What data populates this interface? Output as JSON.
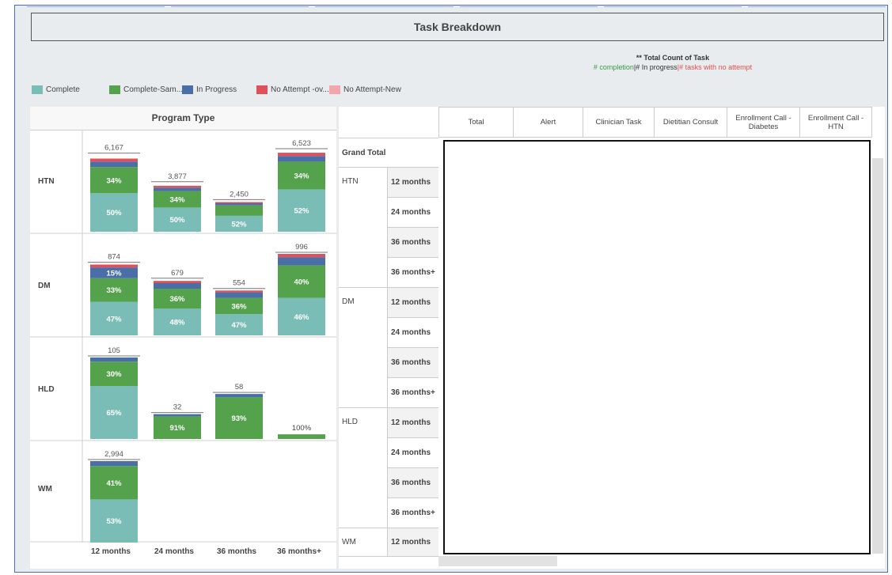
{
  "header": {
    "title": "Task Breakdown",
    "note_title": "** Total Count of Task",
    "note_completion": "# completion",
    "note_sep1": "|",
    "note_progress": "# In progress",
    "note_sep2": "|",
    "note_noattempt": "# tasks with no attempt"
  },
  "legend": [
    {
      "label": "Complete",
      "color": "#79bdb6"
    },
    {
      "label": "Complete-Sam...",
      "color": "#55a24d"
    },
    {
      "label": "In Progress",
      "color": "#4a6fa8"
    },
    {
      "label": "No Attempt -ov...",
      "color": "#e0505a"
    },
    {
      "label": "No Attempt-New",
      "color": "#f4a4ac"
    }
  ],
  "panel_title": "Program Type",
  "chart_data": {
    "type": "bar",
    "stacked": true,
    "title": "Program Type",
    "categories": [
      "12 months",
      "24 months",
      "36 months",
      "36 months+"
    ],
    "rows": [
      "HTN",
      "DM",
      "HLD",
      "WM"
    ],
    "series_names": [
      "Complete",
      "Complete-Sam...",
      "In Progress",
      "No Attempt -ov...",
      "No Attempt-New"
    ],
    "colors": {
      "Complete": "#79bdb6",
      "Complete-Sam...": "#55a24d",
      "In Progress": "#4a6fa8",
      "No Attempt -ov...": "#e0505a",
      "No Attempt-New": "#f4a4ac"
    },
    "panels": [
      {
        "row": "HTN",
        "bars": [
          {
            "category": "12 months",
            "total": 6167,
            "total_label": "6,167",
            "segments": [
              0.5,
              0.34,
              0.07,
              0.04,
              0.0
            ],
            "labels": [
              "50%",
              "34%",
              "",
              "",
              ""
            ]
          },
          {
            "category": "24 months",
            "total": 3877,
            "total_label": "3,877",
            "segments": [
              0.5,
              0.34,
              0.07,
              0.04,
              0.0
            ],
            "labels": [
              "50%",
              "34%",
              "",
              "",
              ""
            ]
          },
          {
            "category": "36 months",
            "total": 2450,
            "total_label": "2,450",
            "segments": [
              0.52,
              0.34,
              0.07,
              0.04,
              0.0
            ],
            "labels": [
              "52%",
              "",
              "",
              "",
              ""
            ]
          },
          {
            "category": "36 months+",
            "total": 6523,
            "total_label": "6,523",
            "segments": [
              0.52,
              0.34,
              0.07,
              0.04,
              0.0
            ],
            "labels": [
              "52%",
              "34%",
              "",
              "",
              ""
            ]
          }
        ]
      },
      {
        "row": "DM",
        "bars": [
          {
            "category": "12 months",
            "total": 874,
            "total_label": "874",
            "segments": [
              0.47,
              0.33,
              0.15,
              0.04,
              0.0
            ],
            "labels": [
              "47%",
              "33%",
              "15%",
              "",
              ""
            ]
          },
          {
            "category": "24 months",
            "total": 679,
            "total_label": "679",
            "segments": [
              0.48,
              0.36,
              0.1,
              0.04,
              0.0
            ],
            "labels": [
              "48%",
              "36%",
              "",
              "",
              ""
            ]
          },
          {
            "category": "36 months",
            "total": 554,
            "total_label": "554",
            "segments": [
              0.47,
              0.36,
              0.12,
              0.04,
              0.0
            ],
            "labels": [
              "47%",
              "36%",
              "",
              "",
              ""
            ]
          },
          {
            "category": "36 months+",
            "total": 996,
            "total_label": "996",
            "segments": [
              0.46,
              0.4,
              0.1,
              0.04,
              0.0
            ],
            "labels": [
              "46%",
              "40%",
              "",
              "",
              ""
            ]
          }
        ]
      },
      {
        "row": "HLD",
        "bars": [
          {
            "category": "12 months",
            "total": 105,
            "total_label": "105",
            "segments": [
              0.65,
              0.3,
              0.05,
              0.0,
              0.0
            ],
            "labels": [
              "65%",
              "30%",
              "",
              "",
              ""
            ]
          },
          {
            "category": "24 months",
            "total": 32,
            "total_label": "32",
            "segments": [
              0.0,
              0.91,
              0.09,
              0.0,
              0.0
            ],
            "labels": [
              "",
              "91%",
              "",
              "",
              ""
            ]
          },
          {
            "category": "36 months",
            "total": 58,
            "total_label": "58",
            "segments": [
              0.0,
              0.93,
              0.07,
              0.0,
              0.0
            ],
            "labels": [
              "",
              "93%",
              "",
              "",
              ""
            ]
          },
          {
            "category": "36 months+",
            "total": 6,
            "total_label": "",
            "segments": [
              0.0,
              1.0,
              0.0,
              0.0,
              0.0
            ],
            "labels": [
              "",
              "",
              "",
              "",
              ""
            ],
            "outside_label": "100%"
          }
        ]
      },
      {
        "row": "WM",
        "bars": [
          {
            "category": "12 months",
            "total": 2994,
            "total_label": "2,994",
            "segments": [
              0.53,
              0.41,
              0.06,
              0.0,
              0.0
            ],
            "labels": [
              "53%",
              "41%",
              "",
              "",
              ""
            ]
          }
        ]
      }
    ]
  },
  "table": {
    "columns": [
      "Total",
      "Alert",
      "Clinician Task",
      "Dietitian Consult",
      "Enrollment Call -\nDiabetes",
      "Enrollment Call -\nHTN"
    ],
    "grand_total": "Grand Total",
    "groups": [
      {
        "name": "HTN",
        "rows": [
          "12 months",
          "24 months",
          "36 months",
          "36 months+"
        ]
      },
      {
        "name": "DM",
        "rows": [
          "12 months",
          "24 months",
          "36 months",
          "36 months+"
        ]
      },
      {
        "name": "HLD",
        "rows": [
          "12 months",
          "24 months",
          "36 months",
          "36 months+"
        ]
      },
      {
        "name": "WM",
        "rows": [
          "12 months"
        ]
      }
    ]
  }
}
